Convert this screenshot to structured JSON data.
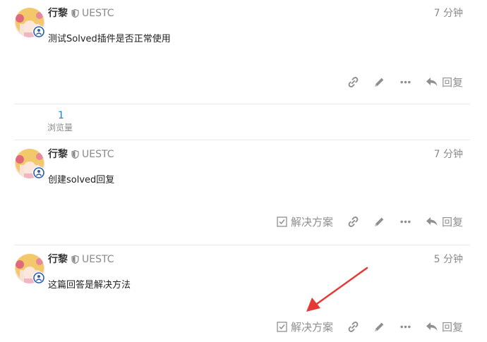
{
  "posts": [
    {
      "username": "行黎",
      "group": "UESTC",
      "time": "7 分钟",
      "content": "测试Solved插件是否正常使用",
      "reply_label": "回复",
      "has_solution_button": false
    },
    {
      "username": "行黎",
      "group": "UESTC",
      "time": "7 分钟",
      "content": "创建solved回复",
      "reply_label": "回复",
      "solution_label": "解决方案",
      "has_solution_button": true
    },
    {
      "username": "行黎",
      "group": "UESTC",
      "time": "5 分钟",
      "content": "这篇回答是解决方法",
      "reply_label": "回复",
      "solution_label": "解决方案",
      "has_solution_button": true
    }
  ],
  "topic_stats": {
    "views_count": "1",
    "views_label": "浏览量"
  },
  "colors": {
    "accent_link": "#0a8bd6",
    "muted": "#8a8a8a",
    "annotation_arrow": "#e53935",
    "moderator_badge": "#2a5db0"
  },
  "icons": [
    "shield-icon",
    "link-icon",
    "pencil-icon",
    "ellipsis-icon",
    "reply-icon",
    "checkbox-icon",
    "moderator-badge-icon"
  ]
}
